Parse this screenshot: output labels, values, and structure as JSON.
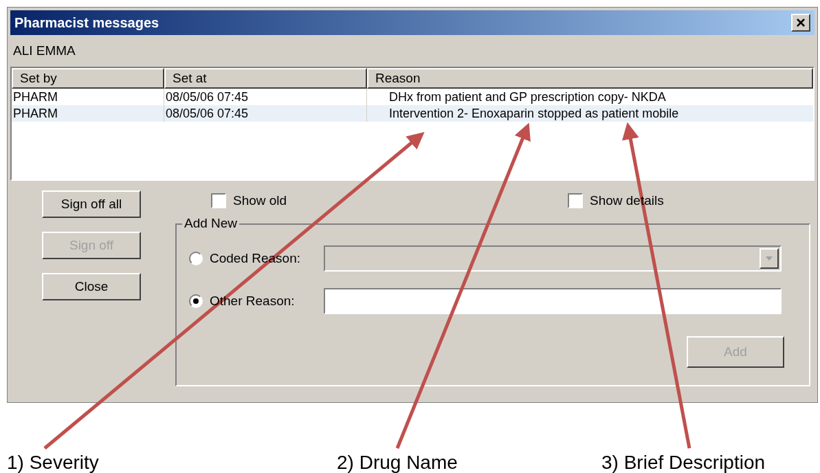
{
  "window": {
    "title": "Pharmacist messages",
    "close": "×"
  },
  "patient": "ALI EMMA",
  "table": {
    "columns": [
      "Set by",
      "Set at",
      "Reason"
    ],
    "rows": [
      {
        "cells": [
          "PHARM",
          "08/05/06 07:45",
          "DHx from patient and GP prescription copy- NKDA"
        ],
        "selected": false
      },
      {
        "cells": [
          "PHARM",
          "08/05/06 07:45",
          "Intervention 2- Enoxaparin stopped as patient mobile"
        ],
        "selected": true
      }
    ]
  },
  "buttons": [
    {
      "label": "Sign off all",
      "disabled": false
    },
    {
      "label": "Sign off",
      "disabled": true
    },
    {
      "label": "Close",
      "disabled": false
    }
  ],
  "checkboxes": [
    {
      "label": "Show old",
      "checked": false
    },
    {
      "label": "Show details",
      "checked": false
    }
  ],
  "add_new": {
    "title": "Add New",
    "options": [
      {
        "label": "Coded Reason:",
        "selected": false,
        "kind": "dropdown",
        "disabled": true
      },
      {
        "label": "Other Reason:",
        "selected": true,
        "kind": "text",
        "disabled": false
      }
    ],
    "add_button": {
      "label": "Add",
      "disabled": true
    }
  },
  "annotations": [
    "1) Severity",
    "2) Drug Name",
    "3) Brief Description"
  ]
}
